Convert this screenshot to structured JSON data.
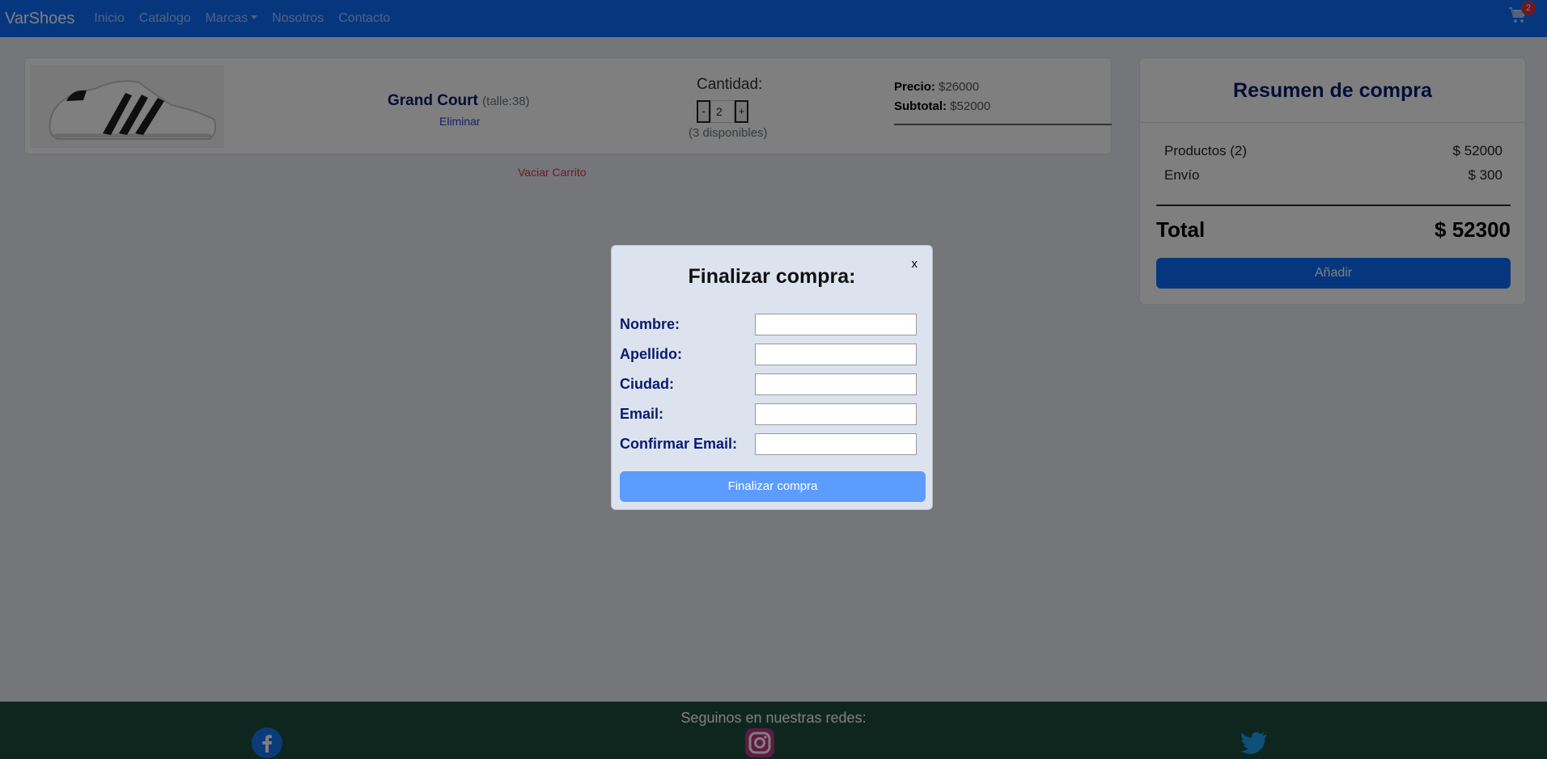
{
  "navbar": {
    "brand": "VarShoes",
    "links": [
      "Inicio",
      "Catalogo",
      "Marcas",
      "Nosotros",
      "Contacto"
    ],
    "cart_count": "2"
  },
  "cart_item": {
    "name": "Grand Court",
    "size": "(talle:38)",
    "remove_label": "Eliminar",
    "quantity_label": "Cantidad:",
    "minus_label": "-",
    "quantity_value": "2",
    "plus_label": "+",
    "available": "(3 disponibles)",
    "price_label": "Precio:",
    "price_value": " $26000",
    "subtotal_label": "Subtotal:",
    "subtotal_value": " $52000"
  },
  "empty_cart_label": "Vaciar Carrito",
  "summary": {
    "title": "Resumen de compra",
    "products_label": "Productos (2)",
    "products_value": "$ 52000",
    "shipping_label": "Envío",
    "shipping_value": "$ 300",
    "total_label": "Total",
    "total_value": "$ 52300",
    "add_button": "Añadir"
  },
  "footer": {
    "title": "Seguinos en nuestras redes:",
    "icons": [
      "facebook-icon",
      "instagram-icon",
      "twitter-icon"
    ]
  },
  "modal": {
    "close_label": "x",
    "title": "Finalizar compra:",
    "fields": {
      "nombre": "Nombre:",
      "apellido": "Apellido:",
      "ciudad": "Ciudad:",
      "email": "Email:",
      "confirm_email": "Confirmar Email:"
    },
    "submit_label": "Finalizar compra"
  },
  "colors": {
    "primary": "#0d6efd",
    "footer": "#1f4d3d",
    "heading": "#0a1a6e",
    "danger": "#dc3545"
  }
}
